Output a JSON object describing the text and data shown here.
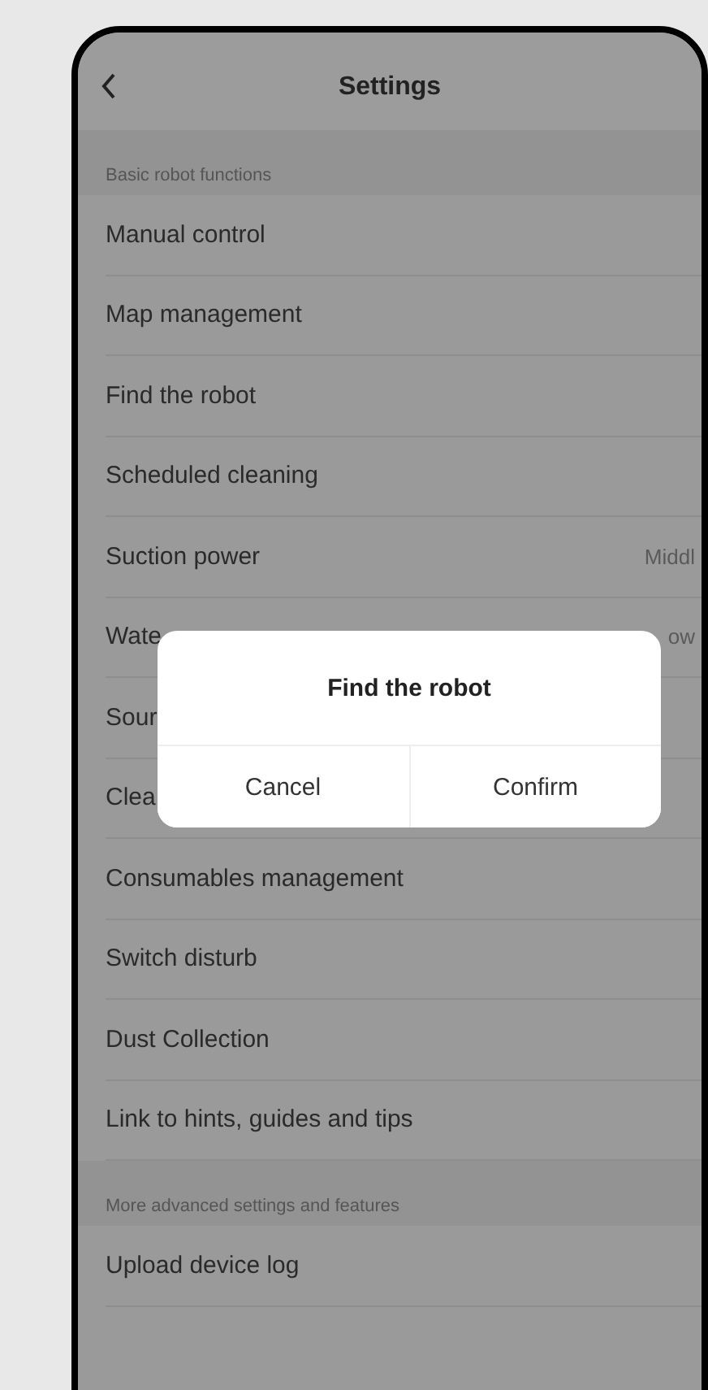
{
  "header": {
    "title": "Settings"
  },
  "sections": [
    {
      "title": "Basic robot functions",
      "rows": [
        {
          "label": "Manual control"
        },
        {
          "label": "Map management"
        },
        {
          "label": "Find the robot"
        },
        {
          "label": "Scheduled cleaning"
        },
        {
          "label": "Suction power",
          "value": "Middl"
        },
        {
          "label": "Wate",
          "value": "ow"
        },
        {
          "label": "Sour"
        },
        {
          "label": "Clea"
        },
        {
          "label": "Consumables management"
        },
        {
          "label": "Switch disturb"
        },
        {
          "label": "Dust Collection"
        },
        {
          "label": "Link to hints, guides and tips"
        }
      ]
    },
    {
      "title": "More advanced settings and features",
      "rows": [
        {
          "label": "Upload device log"
        }
      ]
    }
  ],
  "dialog": {
    "title": "Find the robot",
    "buttons": [
      "Cancel",
      "Confirm"
    ]
  }
}
